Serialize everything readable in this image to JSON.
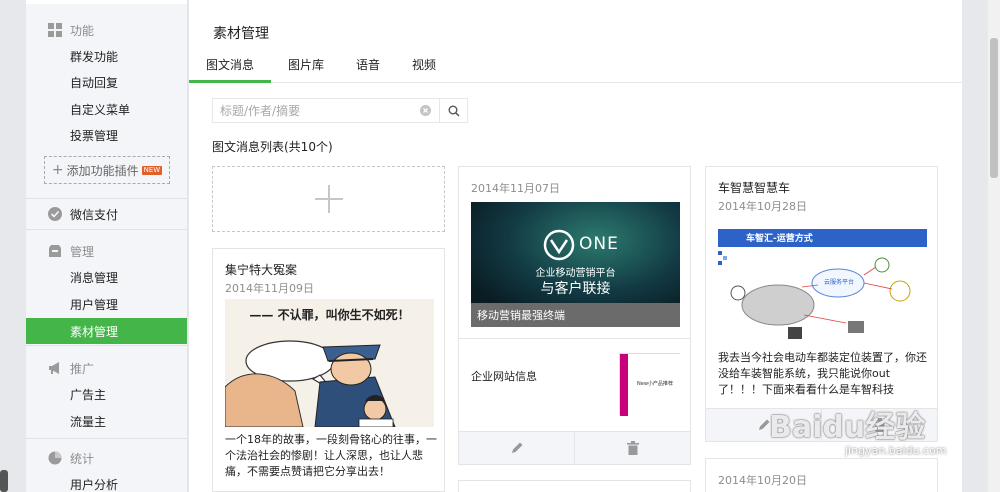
{
  "sidebar": {
    "sections": [
      {
        "icon": "grid-icon",
        "label": "功能",
        "items": [
          "群发功能",
          "自动回复",
          "自定义菜单",
          "投票管理"
        ]
      },
      {
        "icon": "wechat-pay-icon",
        "label": "微信支付",
        "items": []
      },
      {
        "icon": "inbox-icon",
        "label": "管理",
        "items": [
          "消息管理",
          "用户管理",
          "素材管理"
        ]
      },
      {
        "icon": "megaphone-icon",
        "label": "推广",
        "items": [
          "广告主",
          "流量主"
        ]
      },
      {
        "icon": "pie-chart-icon",
        "label": "统计",
        "items": [
          "用户分析"
        ]
      }
    ],
    "plugin_button": "添加功能插件",
    "plugin_badge": "NEW",
    "active_item": "素材管理"
  },
  "main": {
    "title": "素材管理",
    "tabs": [
      "图文消息",
      "图片库",
      "语音",
      "视频"
    ],
    "active_tab": "图文消息",
    "search": {
      "placeholder": "标题/作者/摘要"
    },
    "list_title": "图文消息列表(共10个)"
  },
  "cards": [
    {
      "title": "集宁特大冤案",
      "date": "2014年11月09日",
      "cover_caption": "—— 不认罪，叫你生不如死！",
      "summary": "一个18年的故事，一段刻骨铭心的往事，一个法治社会的惨剧！让人深思，也让人悲痛，不需要点赞请把它分享出去！"
    },
    {
      "date": "2014年11月07日",
      "cover_logo": "ONE",
      "cover_line1": "企业移动营销平台",
      "cover_line2": "与客户联接",
      "cover_title": "移动营销最强终端",
      "sub_item_title": "企业网站信息",
      "sub_item_thumb_text": "New小产品推荐"
    },
    {
      "title": "车智慧智慧车",
      "date": "2014年10月28日",
      "cover_banner": "车智汇-运营方式",
      "cover_center": "云服务平台",
      "summary": "我去当今社会电动车都装定位装置了，你还没给车装智能系统，我只能说你out了！！！下面来看看什么是车智科技"
    },
    {
      "date": "2014年10月20日"
    }
  ],
  "watermark": {
    "text": "Baidu经验",
    "sub": "jingyan.baidu.com"
  },
  "colors": {
    "accent": "#44b549",
    "badge": "#e15f2a"
  }
}
